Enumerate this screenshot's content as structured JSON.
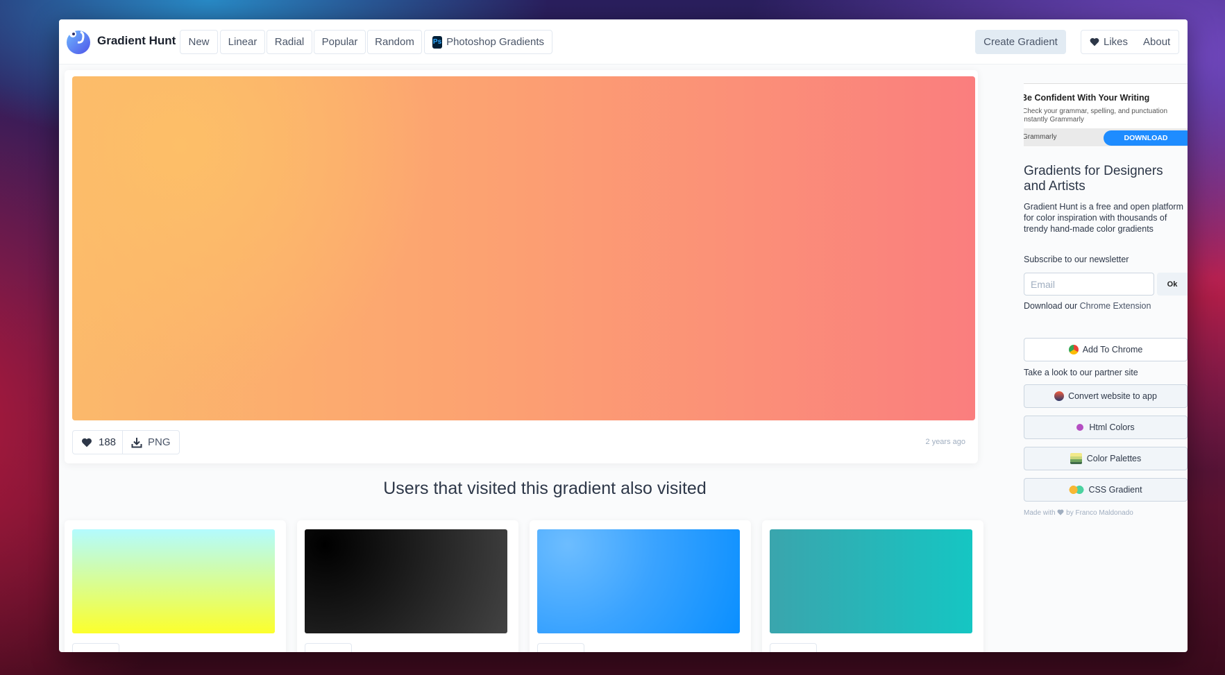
{
  "header": {
    "brand": "Gradient Hunt",
    "nav": [
      "New",
      "Linear",
      "Radial",
      "Popular",
      "Random"
    ],
    "photoshop": "Photoshop Gradients",
    "photoshop_icon": "Ps",
    "create": "Create Gradient",
    "likes": "Likes",
    "about": "About"
  },
  "gradient": {
    "colors": [
      "#fdbf68",
      "#fca271",
      "#fa7e7e"
    ],
    "like_count": "188",
    "download_label": "PNG",
    "age": "2 years ago"
  },
  "related": {
    "title": "Users that visited this gradient also visited",
    "gradients": [
      {
        "colors": [
          "#b3fbff",
          "#fcff2c"
        ]
      },
      {
        "colors": [
          "#000000",
          "#434343"
        ]
      },
      {
        "colors": [
          "#6dbdff",
          "#0a8fff"
        ]
      },
      {
        "colors": [
          "#3aa5ad",
          "#15c6c3"
        ]
      }
    ]
  },
  "ad": {
    "title": "Be Confident With Your Writing",
    "text": "Check your grammar, spelling, and punctuation instantly Grammarly",
    "brand": "Grammarly",
    "cta": "DOWNLOAD"
  },
  "sidebar": {
    "heading": "Gradients for Designers and Artists",
    "description": "Gradient Hunt is a free and open platform for color inspiration with thousands of trendy hand-made color gradients",
    "newsletter_label": "Subscribe to our newsletter",
    "email_placeholder": "Email",
    "ok": "Ok",
    "download_prefix": "Download our",
    "extension_link": "Chrome Extension",
    "add_chrome": "Add To Chrome",
    "partner_label": "Take a look to our partner site",
    "partners": [
      "Convert website to app",
      "Html Colors",
      "Color Palettes",
      "CSS Gradient"
    ],
    "credit_prefix": "Made with",
    "credit_suffix": "by Franco Maldonado"
  }
}
